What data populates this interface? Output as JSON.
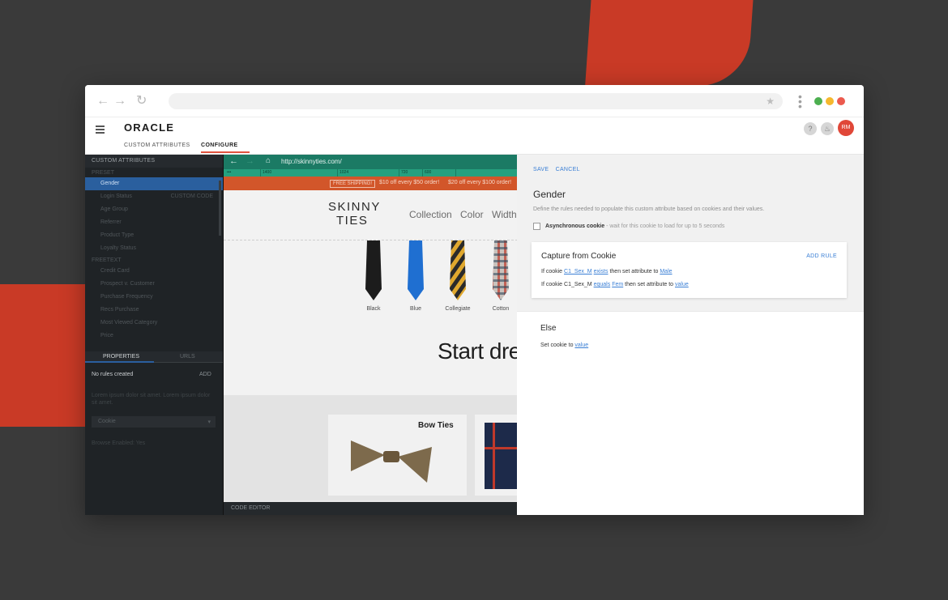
{
  "browser": {
    "back_icon": "arrow-left-icon",
    "forward_icon": "arrow-right-icon",
    "reload_icon": "reload-icon",
    "window_dots": [
      "#4caf50",
      "#f5b82e",
      "#ec5a4e"
    ]
  },
  "app": {
    "logo": "ORACLE",
    "tabs": [
      {
        "label": "CUSTOM ATTRIBUTES"
      },
      {
        "label": "CONFIGURE"
      }
    ],
    "help_icon": "?",
    "avatar": "RM"
  },
  "sidebar": {
    "title": "CUSTOM ATTRIBUTES",
    "preset_label": "PRESET",
    "preset_items": [
      {
        "label": "Gender",
        "right": ""
      },
      {
        "label": "Login Status",
        "right": "CUSTOM CODE"
      },
      {
        "label": "Age Group",
        "right": ""
      },
      {
        "label": "Referrer",
        "right": ""
      },
      {
        "label": "Product Type",
        "right": ""
      },
      {
        "label": "Loyalty Status",
        "right": ""
      }
    ],
    "freetext_label": "FREETEXT",
    "freetext_items": [
      {
        "label": "Credit Card"
      },
      {
        "label": "Prospect v. Customer"
      },
      {
        "label": "Purchase Frequency"
      },
      {
        "label": "Recs Purchase"
      },
      {
        "label": "Most Viewed Category"
      },
      {
        "label": "Price"
      }
    ],
    "bottom_tabs": [
      "PROPERTIES",
      "URLS"
    ],
    "no_rules": "No rules created",
    "add": "ADD",
    "lorem": "Lorem ipsum dolor sit amet. Lorem ipsum dolor sit amet.",
    "select_value": "Cookie",
    "note": "Browse Enabled: Yes"
  },
  "preview": {
    "url": "http://skinnyties.com/",
    "ruler": [
      "1400",
      "1024",
      "720",
      "600"
    ],
    "promo": {
      "badge": "FREE SHIPPING!",
      "text1": "$10 off every $50 order!",
      "text2": "$20 off every $100 order!"
    },
    "site_logo_1": "SKINNY",
    "site_logo_2": "TIES",
    "nav": [
      "Collection",
      "Color",
      "Width"
    ],
    "ties": [
      {
        "label": "Black"
      },
      {
        "label": "Blue"
      },
      {
        "label": "Collegiate"
      },
      {
        "label": "Cotton"
      }
    ],
    "headline": "Start dre",
    "card_title": "Bow Ties",
    "code_editor": "CODE EDITOR"
  },
  "panel": {
    "save": "SAVE",
    "cancel": "CANCEL",
    "title": "Gender",
    "description": "Define the rules needed to populate this custom attribute based on cookies and their values.",
    "async_label": "Asynchronous cookie",
    "async_desc": " - wait for this cookie to load for up to 5 seconds",
    "card_title": "Capture from Cookie",
    "add_rule": "ADD RULE",
    "rule1": {
      "pre": "If cookie ",
      "cookie": "C1_Sex_M",
      "sp": " ",
      "op": "exists",
      "mid": " then set attribute to ",
      "value": "Male"
    },
    "rule2": {
      "pre": "If cookie C1_Sex_M ",
      "op": "equals",
      "sp": " ",
      "val": "Fem",
      "mid": " then set attribute to ",
      "value": "value"
    },
    "else_title": "Else",
    "else_pre": "Set cookie to ",
    "else_value": "value"
  }
}
